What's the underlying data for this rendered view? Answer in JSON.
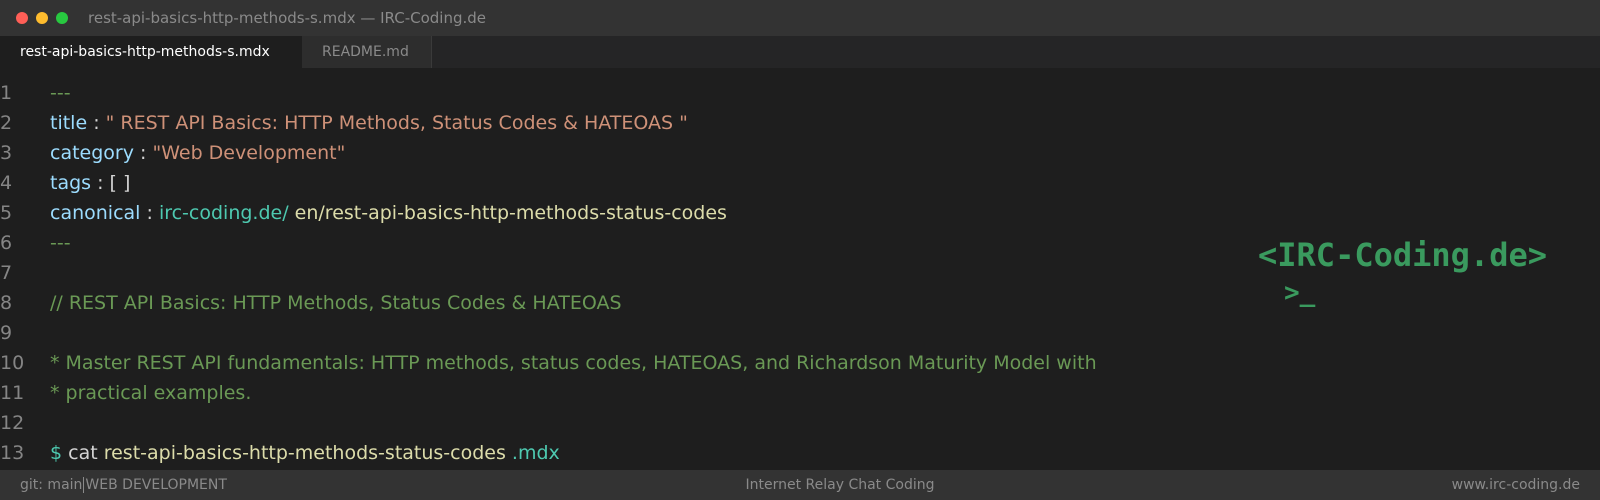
{
  "window": {
    "title": "rest-api-basics-http-methods-s.mdx — IRC-Coding.de"
  },
  "tabs": [
    {
      "label": "rest-api-basics-http-methods-s.mdx",
      "active": true
    },
    {
      "label": "README.md",
      "active": false
    }
  ],
  "editor": {
    "lines": [
      {
        "num": "1",
        "dashes": "---"
      },
      {
        "num": "2",
        "key": "title",
        "sep": " : ",
        "value": "\" REST API Basics: HTTP Methods, Status Codes & HATEOAS \""
      },
      {
        "num": "3",
        "key": "category",
        "sep": " : ",
        "value": "\"Web Development\""
      },
      {
        "num": "4",
        "key": "tags",
        "sep": " : ",
        "value": "[ ]"
      },
      {
        "num": "5",
        "key": "canonical",
        "sep": " : ",
        "url": "irc-coding.de/",
        "path": " en/rest-api-basics-http-methods-status-codes"
      },
      {
        "num": "6",
        "dashes": "---"
      },
      {
        "num": "7"
      },
      {
        "num": "8",
        "comment": "// REST API Basics: HTTP Methods, Status Codes & HATEOAS"
      },
      {
        "num": "9"
      },
      {
        "num": "10",
        "comment": "* Master REST API fundamentals: HTTP methods, status codes, HATEOAS, and Richardson Maturity Model with"
      },
      {
        "num": "11",
        "comment": "* practical examples."
      },
      {
        "num": "12"
      },
      {
        "num": "13",
        "prompt": "$",
        "cmd": " cat ",
        "file": "rest-api-basics-http-methods-status-codes",
        "ext": " .mdx"
      }
    ]
  },
  "brand": {
    "logo": "<IRC-Coding.de>",
    "cursor": ">_"
  },
  "statusbar": {
    "branch": "git: main",
    "category": "WEB DEVELOPMENT",
    "center": "Internet Relay Chat Coding",
    "right": "www.irc-coding.de"
  },
  "colors": {
    "background": "#1e1e1e",
    "chrome": "#333333",
    "key": "#9cdcfe",
    "string": "#ce9178",
    "comment": "#6a9955",
    "url": "#4ec9b0",
    "path": "#dcdcaa",
    "brand": "#3a9a5e"
  }
}
